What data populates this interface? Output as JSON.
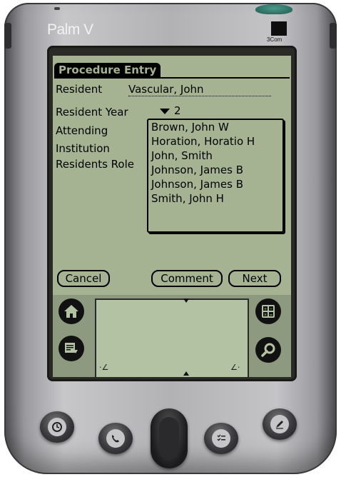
{
  "device": {
    "brand": "Palm V",
    "logo_text": "3Com"
  },
  "form": {
    "title": "Procedure Entry",
    "resident_label": "Resident",
    "resident_value": "Vascular, John",
    "resident_year_label": "Resident Year",
    "resident_year_value": "2",
    "attending_label": "Attending",
    "institution_label": "Institution",
    "residents_role_label": "Residents Role"
  },
  "attending_list": {
    "items": [
      "Brown, John W",
      "Horation, Horatio H",
      "John, Smith",
      "Johnson, James B",
      "Johnson, James B",
      "Smith, John H"
    ]
  },
  "buttons": {
    "cancel": "Cancel",
    "comment": "Comment",
    "next": "Next"
  },
  "silk_icons": [
    "home-icon",
    "menu-icon",
    "calculator-icon",
    "find-icon"
  ],
  "hardware_buttons": [
    "date-book-icon",
    "phone-book-icon",
    "to-do-list-icon",
    "memo-pad-icon"
  ],
  "colors": {
    "lcd": "#a5b393",
    "graffiti_bg": "#8d9a80",
    "ink": "#000000",
    "top_button": "#2f7a6c"
  }
}
